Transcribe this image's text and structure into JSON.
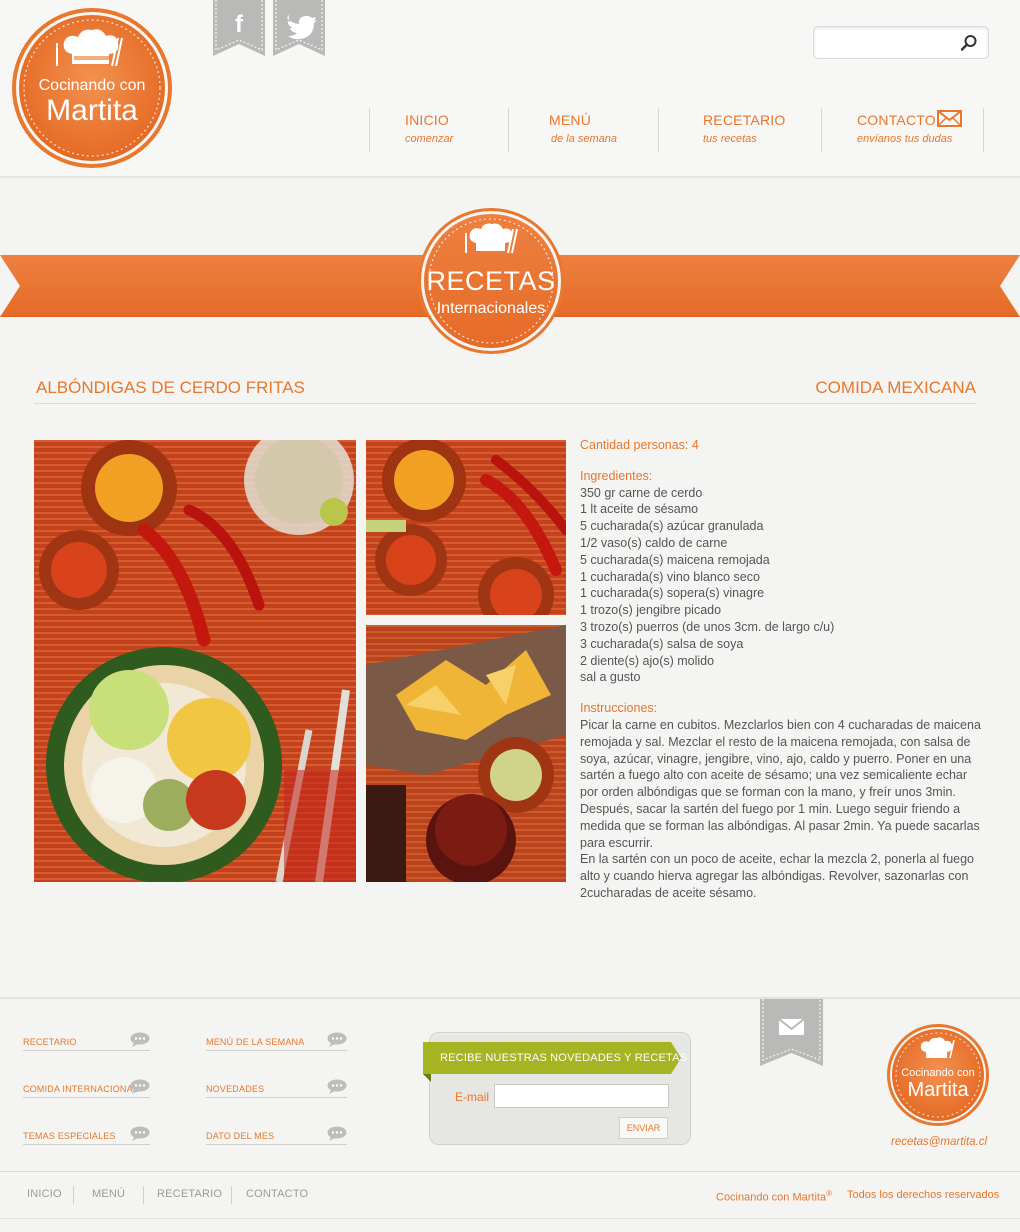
{
  "brand": {
    "logo_line1": "Cocinando con",
    "logo_line2": "Martita",
    "accent_color": "#e9772c"
  },
  "header": {
    "social": [
      {
        "name": "facebook",
        "glyph": "f"
      },
      {
        "name": "twitter",
        "glyph": "twitter-bird"
      }
    ],
    "search": {
      "placeholder": "",
      "icon": "search-icon"
    },
    "nav": [
      {
        "title": "INICIO",
        "subtitle": "comenzar"
      },
      {
        "title": "MENÚ",
        "subtitle": "de la semana"
      },
      {
        "title": "RECETARIO",
        "subtitle": "tus recetas"
      },
      {
        "title": "CONTACTO",
        "subtitle": "envíanos tus dudas",
        "icon": "envelope-icon"
      }
    ]
  },
  "banner": {
    "title": "RECETAS",
    "subtitle": "Internacionales"
  },
  "recipe": {
    "title": "ALBÓNDIGAS DE CERDO FRITAS",
    "category": "COMIDA MEXICANA",
    "servings": "Cantidad personas: 4",
    "ingredients_label": "Ingredientes:",
    "ingredients": [
      "350 gr carne de cerdo",
      "1 lt aceite de sésamo",
      "5 cucharada(s) azúcar granulada",
      "1/2 vaso(s) caldo de carne",
      "5 cucharada(s) maicena remojada",
      "1 cucharada(s) vino blanco seco",
      "1 cucharada(s) sopera(s) vinagre",
      "1 trozo(s) jengibre picado",
      "3 trozo(s) puerros (de unos 3cm. de largo c/u)",
      "3 cucharada(s) salsa de soya",
      "2 diente(s) ajo(s) molido",
      "sal a gusto"
    ],
    "instructions_label": "Instrucciones:",
    "instructions": [
      "Picar la carne en cubitos. Mezclarlos bien con 4 cucharadas de maicena remojada y sal. Mezclar el resto de la maicena remojada, con salsa de soya, azúcar, vinagre, jengibre, vino, ajo, caldo y puerro. Poner en una sartén a fuego alto con aceite de sésamo; una vez semicaliente echar por orden albóndigas que se forman con la mano, y freír unos 3min. Después, sacar la sartén del fuego por 1 min. Luego seguir friendo a medida que se forman las albóndigas. Al pasar 2min. Ya puede sacarlas para escurrir.",
      "En la sartén con un poco de aceite, echar la mezcla 2, ponerla al fuego alto y cuando hierva agregar las albóndigas. Revolver, sazonarlas con 2cucharadas de aceite sésamo."
    ]
  },
  "footer": {
    "links_col1": [
      "RECETARIO",
      "COMIDA INTERNACIONAL",
      "TEMAS ESPECIALES"
    ],
    "links_col2": [
      "MENÚ DE LA SEMANA",
      "NOVEDADES",
      "DATO DEL MES"
    ],
    "newsletter": {
      "title": "RECIBE NUESTRAS NOVEDADES Y RECETAS",
      "email_label": "E-mail",
      "email_value": "",
      "button": "ENVIAR"
    },
    "contact_email": "recetas@martita.cl",
    "bottom_nav": [
      "INICIO",
      "MENÚ",
      "RECETARIO",
      "CONTACTO"
    ],
    "copyright_brand": "Cocinando con Martita",
    "copyright_mark": "®",
    "rights": "Todos los derechos reservados"
  }
}
